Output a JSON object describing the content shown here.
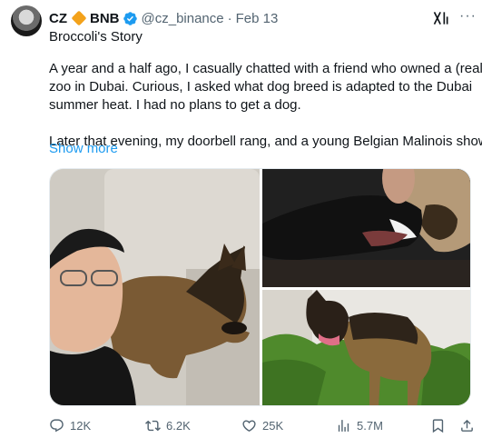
{
  "author": {
    "name": "CZ",
    "org": "BNB",
    "handle": "@cz_binance",
    "date": "Feb 13"
  },
  "tweet": {
    "title": "Broccoli's Story",
    "paragraphs": [
      [
        "A year and a half ago, I casually chatted with a friend who owned a (real)",
        "zoo in Dubai. Curious, I asked what dog breed is adapted to the Dubai",
        "summer heat. I had no plans to get a dog."
      ],
      [
        "Later that evening, my doorbell rang, and a young Belgian Malinois showed"
      ]
    ],
    "show_more": "Show more"
  },
  "actions": {
    "replies": "12K",
    "reposts": "6.2K",
    "likes": "25K",
    "views": "5.7M"
  },
  "icons": {
    "org_badge": "gold-diamond-icon",
    "verified": "verified-badge-icon",
    "grok": "grok-icon",
    "more": "more-options-icon",
    "reply": "reply-icon",
    "repost": "repost-icon",
    "like": "heart-icon",
    "views": "views-icon",
    "bookmark": "bookmark-icon",
    "share": "share-icon"
  },
  "colors": {
    "accent": "#1d9bf0",
    "secondary_text": "#536471",
    "text": "#0f1419",
    "org_badge": "#f3a21b"
  }
}
